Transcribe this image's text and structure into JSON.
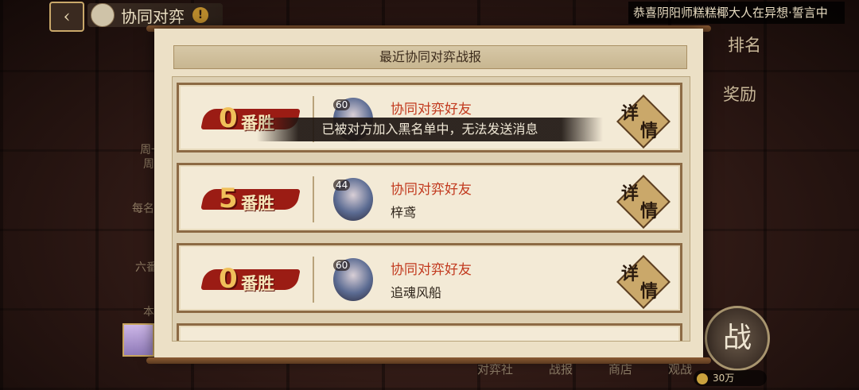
{
  "header": {
    "title": "协同对弈",
    "warn_symbol": "!",
    "back_symbol": "‹",
    "marquee": "恭喜阴阳师糕糕椰大人在异想·誓言中"
  },
  "side": {
    "rank_label": "排名",
    "reward_label": "奖励",
    "battle_label": "战",
    "coins": "30万"
  },
  "bottom_tabs": [
    "对弈社",
    "战报",
    "商店",
    "观战"
  ],
  "left_texts": [
    "周一",
    "周",
    "每名",
    "六番",
    "本"
  ],
  "panel": {
    "title": "最近协同对弈战报",
    "records": [
      {
        "streak_num": "0",
        "streak_word": "番胜",
        "level": "60",
        "mode": "协同对弈好友",
        "player": "",
        "detail_1": "详",
        "detail_2": "情"
      },
      {
        "streak_num": "5",
        "streak_word": "番胜",
        "level": "44",
        "mode": "协同对弈好友",
        "player": "梓鸢",
        "detail_1": "详",
        "detail_2": "情"
      },
      {
        "streak_num": "0",
        "streak_word": "番胜",
        "level": "60",
        "mode": "协同对弈好友",
        "player": "追魂风船",
        "detail_1": "详",
        "detail_2": "情"
      }
    ]
  },
  "toast": "已被对方加入黑名单中，无法发送消息",
  "colors": {
    "brush_red": "#9b1c14",
    "mode_red": "#c23a1f",
    "parchment": "#f3ead6"
  }
}
